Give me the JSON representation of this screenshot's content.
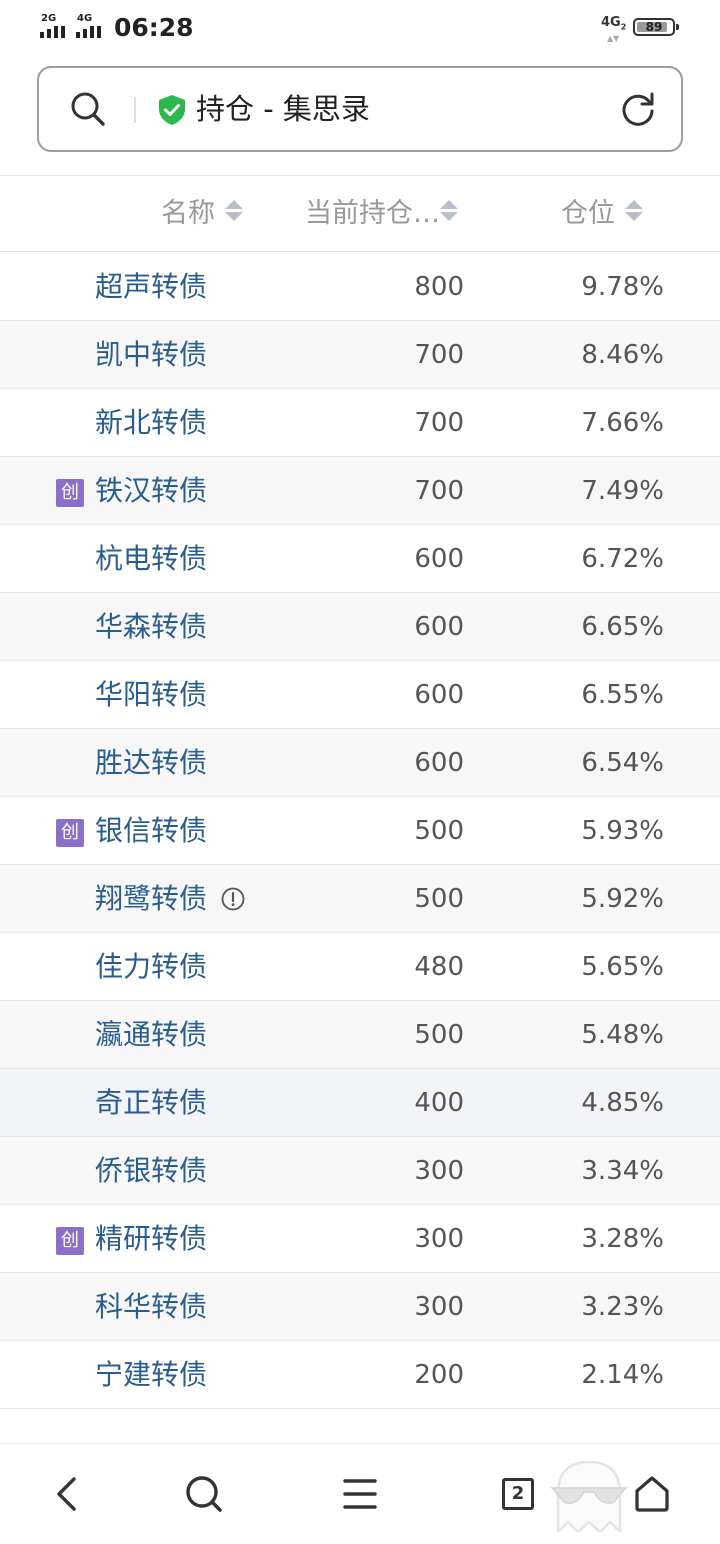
{
  "status_bar": {
    "sim1_network": "2G",
    "sim2_network": "4G",
    "time": "06:28",
    "right_network": "4G",
    "right_network_sub": "2",
    "battery_percent": 89
  },
  "address_bar": {
    "page_title": "持仓 - 集思录"
  },
  "table": {
    "columns": [
      "名称",
      "当前持仓…",
      "仓位"
    ],
    "badge_label": "创",
    "rows": [
      {
        "name": "超声转债",
        "qty": "800",
        "pct": "9.78%",
        "badge": false,
        "warn": false
      },
      {
        "name": "凯中转债",
        "qty": "700",
        "pct": "8.46%",
        "badge": false,
        "warn": false
      },
      {
        "name": "新北转债",
        "qty": "700",
        "pct": "7.66%",
        "badge": false,
        "warn": false
      },
      {
        "name": "铁汉转债",
        "qty": "700",
        "pct": "7.49%",
        "badge": true,
        "warn": false
      },
      {
        "name": "杭电转债",
        "qty": "600",
        "pct": "6.72%",
        "badge": false,
        "warn": false
      },
      {
        "name": "华森转债",
        "qty": "600",
        "pct": "6.65%",
        "badge": false,
        "warn": false
      },
      {
        "name": "华阳转债",
        "qty": "600",
        "pct": "6.55%",
        "badge": false,
        "warn": false
      },
      {
        "name": "胜达转债",
        "qty": "600",
        "pct": "6.54%",
        "badge": false,
        "warn": false
      },
      {
        "name": "银信转债",
        "qty": "500",
        "pct": "5.93%",
        "badge": true,
        "warn": false
      },
      {
        "name": "翔鹭转债",
        "qty": "500",
        "pct": "5.92%",
        "badge": false,
        "warn": true
      },
      {
        "name": "佳力转债",
        "qty": "480",
        "pct": "5.65%",
        "badge": false,
        "warn": false
      },
      {
        "name": "瀛通转债",
        "qty": "500",
        "pct": "5.48%",
        "badge": false,
        "warn": false
      },
      {
        "name": "奇正转债",
        "qty": "400",
        "pct": "4.85%",
        "badge": false,
        "warn": false
      },
      {
        "name": "侨银转债",
        "qty": "300",
        "pct": "3.34%",
        "badge": false,
        "warn": false
      },
      {
        "name": "精研转债",
        "qty": "300",
        "pct": "3.28%",
        "badge": true,
        "warn": false
      },
      {
        "name": "科华转债",
        "qty": "300",
        "pct": "3.23%",
        "badge": false,
        "warn": false
      },
      {
        "name": "宁建转债",
        "qty": "200",
        "pct": "2.14%",
        "badge": false,
        "warn": false
      }
    ]
  },
  "bottom_nav": {
    "tab_count": "2",
    "icons": [
      "back-icon",
      "search-icon",
      "menu-icon",
      "tabs-icon",
      "incognito-ghost-icon",
      "home-icon"
    ]
  },
  "colors": {
    "name_link": "#2a5d8f",
    "badge_bg": "#8b6fc8",
    "secure_shield": "#2db84d",
    "sort_arrow": "#b8c0cc"
  }
}
